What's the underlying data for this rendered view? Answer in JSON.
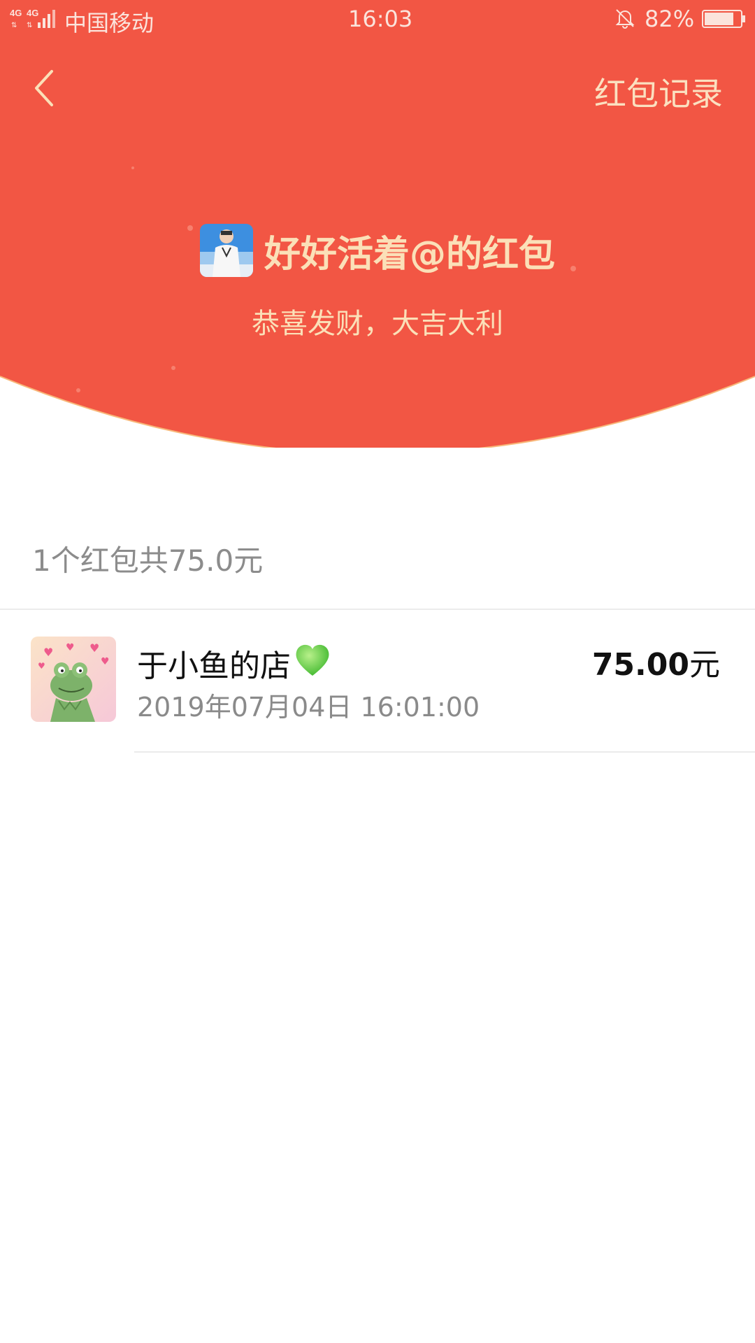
{
  "status_bar": {
    "network": "4G 4G",
    "carrier": "中国移动",
    "time": "16:03",
    "battery": "82%",
    "battery_level": 0.82,
    "icons": [
      "signal-icon",
      "bell-off-icon",
      "battery-icon"
    ]
  },
  "nav": {
    "back_icon": "chevron-left-icon",
    "records_label": "红包记录"
  },
  "red_packet": {
    "sender_title": "好好活着@的红包",
    "greeting": "恭喜发财，大吉大利"
  },
  "summary": {
    "text": "1个红包共75.0元"
  },
  "list": [
    {
      "name": "于小鱼的店",
      "emoji": "green-heart-icon",
      "time": "2019年07月04日 16:01:00",
      "amount": "75.00",
      "unit": "元"
    }
  ],
  "colors": {
    "header_red": "#f25644",
    "header_text": "#fbe0b8",
    "arc_border": "#f8b87a"
  }
}
